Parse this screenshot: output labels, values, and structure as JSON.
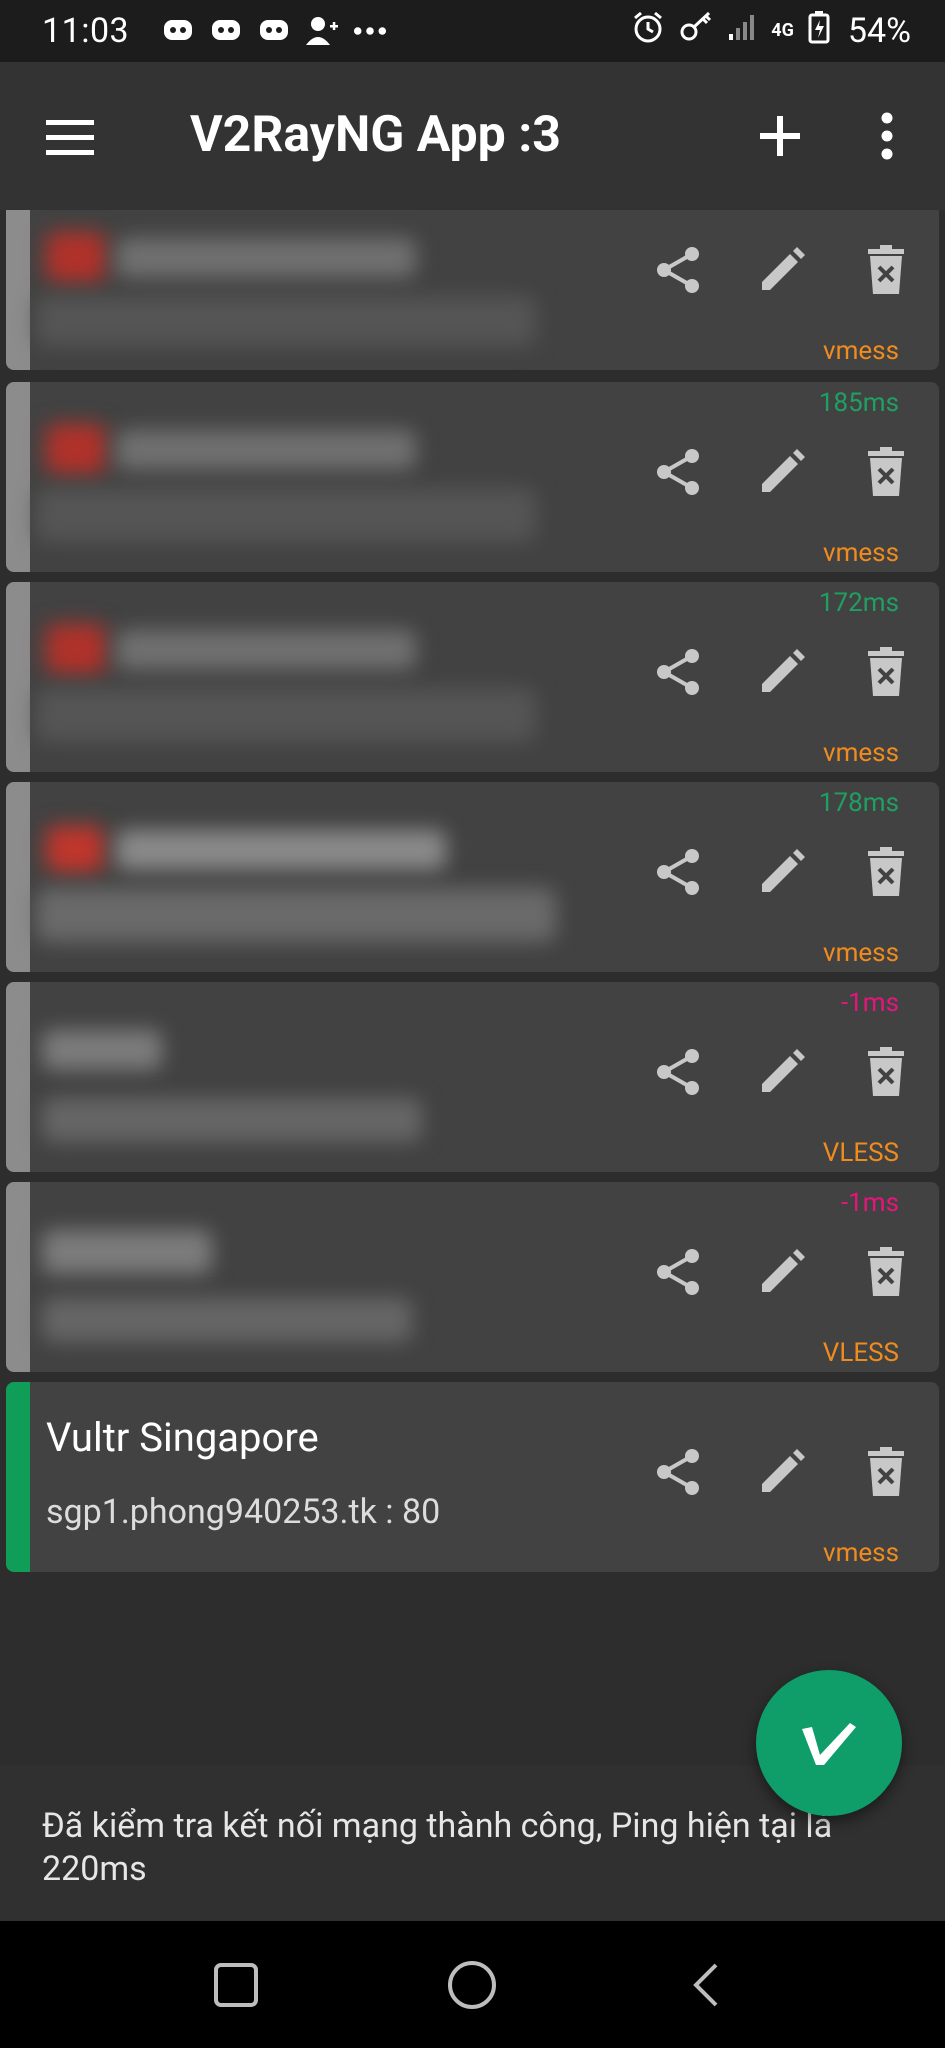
{
  "status_bar": {
    "time": "11:03",
    "network": "4G",
    "battery": "54%"
  },
  "app_bar": {
    "title": "V2RayNG App :3",
    "icons": [
      "menu-icon",
      "add-icon",
      "more-vert-icon"
    ]
  },
  "servers": [
    {
      "name": "",
      "address": "",
      "ping": "",
      "type": "vmess",
      "selected": false
    },
    {
      "name": "",
      "address": "",
      "ping": "185ms",
      "type": "vmess",
      "selected": false
    },
    {
      "name": "",
      "address": "",
      "ping": "172ms",
      "type": "vmess",
      "selected": false
    },
    {
      "name": "",
      "address": "",
      "ping": "178ms",
      "type": "vmess",
      "selected": false
    },
    {
      "name": "",
      "address": "",
      "ping": "-1ms",
      "type": "VLESS",
      "selected": false
    },
    {
      "name": "",
      "address": "",
      "ping": "-1ms",
      "type": "VLESS",
      "selected": false
    },
    {
      "name": "Vultr Singapore",
      "address": "sgp1.phong940253.tk : 80",
      "ping": "",
      "type": "vmess",
      "selected": true
    }
  ],
  "colors": {
    "accent": "#0f9d58",
    "ping_ok": "#1fa063",
    "ping_fail": "#e7147e",
    "protocol": "#f08c1e"
  },
  "message": {
    "text": "Đã kiểm tra kết nối mạng thành công, Ping hiện tại là 220ms"
  }
}
